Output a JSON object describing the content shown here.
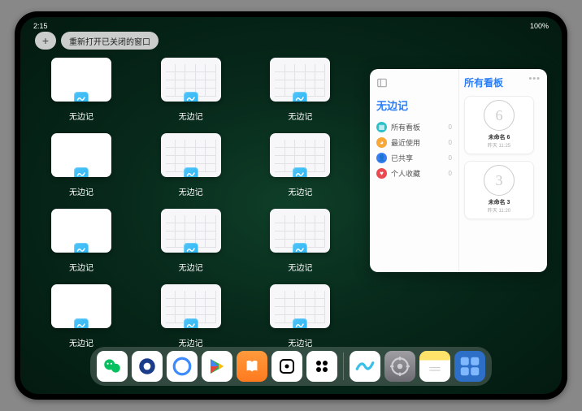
{
  "status": {
    "time": "2:15",
    "battery": "100%"
  },
  "plus": "+",
  "reopen_label": "重新打开已关闭的窗口",
  "app_name": "无边记",
  "windows": [
    {
      "label": "无边记",
      "variant": "blank"
    },
    {
      "label": "无边记",
      "variant": "cal"
    },
    {
      "label": "无边记",
      "variant": "cal"
    },
    {
      "label": "无边记",
      "variant": "blank"
    },
    {
      "label": "无边记",
      "variant": "cal"
    },
    {
      "label": "无边记",
      "variant": "cal"
    },
    {
      "label": "无边记",
      "variant": "blank"
    },
    {
      "label": "无边记",
      "variant": "cal"
    },
    {
      "label": "无边记",
      "variant": "cal"
    },
    {
      "label": "无边记",
      "variant": "blank"
    },
    {
      "label": "无边记",
      "variant": "cal"
    },
    {
      "label": "无边记",
      "variant": "cal"
    }
  ],
  "panel": {
    "title": "无边记",
    "right_title": "所有看板",
    "items": [
      {
        "icon_color": "#2cc0c9",
        "label": "所有看板",
        "count": "0"
      },
      {
        "icon_color": "#f7a838",
        "label": "最近使用",
        "count": "0"
      },
      {
        "icon_color": "#3b7ef0",
        "label": "已共享",
        "count": "0"
      },
      {
        "icon_color": "#ea4a52",
        "label": "个人收藏",
        "count": "0"
      }
    ],
    "boards": [
      {
        "sketch": "6",
        "label": "未命名 6",
        "sub": "昨天 11:25"
      },
      {
        "sketch": "3",
        "label": "未命名 3",
        "sub": "昨天 11:20"
      }
    ]
  },
  "dock": [
    {
      "name": "wechat",
      "bg": "#ffffff"
    },
    {
      "name": "qqbrowser",
      "bg": "#ffffff"
    },
    {
      "name": "quark",
      "bg": "#ffffff"
    },
    {
      "name": "play",
      "bg": "#ffffff"
    },
    {
      "name": "books",
      "bg": "linear-gradient(180deg,#ff9a3c,#ff7a1f)"
    },
    {
      "name": "dice",
      "bg": "#ffffff"
    },
    {
      "name": "game",
      "bg": "#ffffff"
    },
    {
      "name": "freeform",
      "bg": "#ffffff"
    },
    {
      "name": "settings",
      "bg": "linear-gradient(180deg,#9e9ea3,#6c6c72)"
    },
    {
      "name": "notes",
      "bg": "linear-gradient(180deg,#ffe26a 30%,#fff 30%)"
    },
    {
      "name": "folder",
      "bg": "#2d6fc7"
    }
  ]
}
